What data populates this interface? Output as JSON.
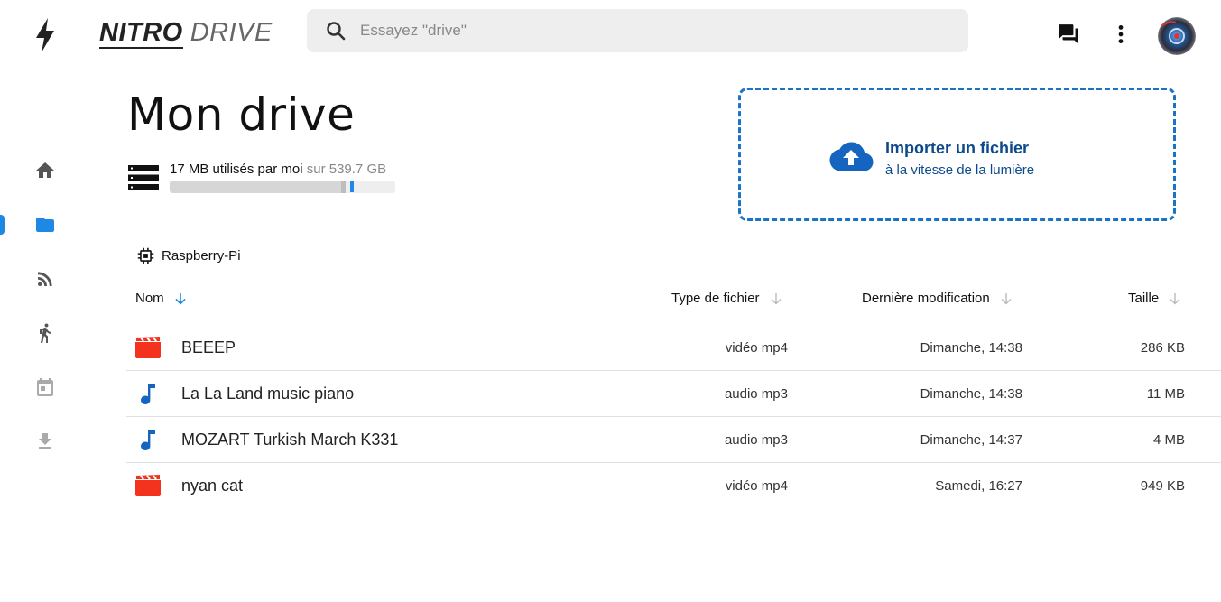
{
  "app": {
    "logo_bold": "NITRO",
    "logo_light": "DRIVE",
    "accent": "#1e88e5",
    "brand_blue": "#0d4a8c"
  },
  "search": {
    "placeholder": "Essayez \"drive\"",
    "value": ""
  },
  "topbar_icons": [
    "lightning-bolt-icon",
    "search-icon",
    "forum-icon",
    "more-vert-icon",
    "avatar"
  ],
  "sidebar": {
    "items": [
      {
        "icon": "home-icon",
        "active": false
      },
      {
        "icon": "folder-icon",
        "active": true
      },
      {
        "icon": "rss-feed-icon",
        "active": false
      },
      {
        "icon": "running-person-icon",
        "active": false
      },
      {
        "icon": "calendar-icon",
        "active": false
      },
      {
        "icon": "download-icon",
        "active": false
      }
    ]
  },
  "page": {
    "title": "Mon drive",
    "storage_used": "17 MB utilisés par moi",
    "storage_total": "sur 539.7 GB",
    "storage_used_fraction": 0.76
  },
  "upload": {
    "title": "Importer un fichier",
    "subtitle": "à la vitesse de la lumière"
  },
  "device": {
    "name": "Raspberry-Pi",
    "icon": "chip-icon"
  },
  "table": {
    "columns": [
      {
        "label": "Nom",
        "sort": "active-asc"
      },
      {
        "label": "Type de fichier",
        "sort": "inactive"
      },
      {
        "label": "Dernière modification",
        "sort": "inactive"
      },
      {
        "label": "Taille",
        "sort": "inactive"
      }
    ],
    "rows": [
      {
        "name": "BEEEP",
        "type": "vidéo mp4",
        "modified": "Dimanche, 14:38",
        "size": "286 KB",
        "icon": "video-icon"
      },
      {
        "name": "La La Land music piano",
        "type": "audio mp3",
        "modified": "Dimanche, 14:38",
        "size": "11 MB",
        "icon": "music-note-icon"
      },
      {
        "name": "MOZART Turkish March K331",
        "type": "audio mp3",
        "modified": "Dimanche, 14:37",
        "size": "4 MB",
        "icon": "music-note-icon"
      },
      {
        "name": "nyan cat",
        "type": "vidéo mp4",
        "modified": "Samedi, 16:27",
        "size": "949 KB",
        "icon": "video-icon"
      }
    ]
  }
}
